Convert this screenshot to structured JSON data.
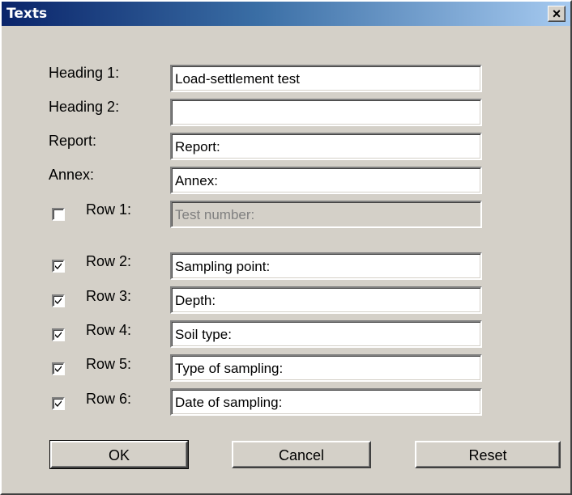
{
  "window": {
    "title": "Texts",
    "close_glyph": "×"
  },
  "fields": [
    {
      "label": "Heading 1:",
      "value": "Load-settlement test",
      "has_checkbox": false
    },
    {
      "label": "Heading 2:",
      "value": "",
      "has_checkbox": false
    },
    {
      "label": "Report:",
      "value": "Report:",
      "has_checkbox": false
    },
    {
      "label": "Annex:",
      "value": "Annex:",
      "has_checkbox": false
    },
    {
      "label": "Row 1:",
      "value": "Test number:",
      "has_checkbox": true,
      "checked": false,
      "disabled": true
    },
    {
      "label": "Row 2:",
      "value": "Sampling point:",
      "has_checkbox": true,
      "checked": true
    },
    {
      "label": "Row 3:",
      "value": "Depth:",
      "has_checkbox": true,
      "checked": true
    },
    {
      "label": "Row 4:",
      "value": "Soil type:",
      "has_checkbox": true,
      "checked": true
    },
    {
      "label": "Row 5:",
      "value": "Type of sampling:",
      "has_checkbox": true,
      "checked": true
    },
    {
      "label": "Row 6:",
      "value": "Date of sampling:",
      "has_checkbox": true,
      "checked": true
    }
  ],
  "buttons": {
    "ok": "OK",
    "cancel": "Cancel",
    "reset": "Reset"
  }
}
